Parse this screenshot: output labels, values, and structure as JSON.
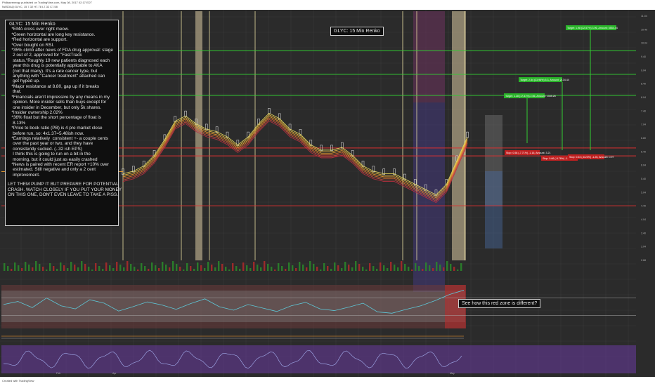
{
  "header": {
    "line1": "Phillyseenergy published on TradingView.com, May 08, 2017 02:17 EDT",
    "line2": "NASDAQ:GLYC, 15 7.32 H7.78 L7.32 C7.58"
  },
  "footer": {
    "credit": "Created with TradingView"
  },
  "note": {
    "title": "GLYC: 15 Min Renko",
    "lines": [
      "   *EMA cross over right meow.",
      "   *Green horizontal are long key resistance.",
      "   *Red horizontal are support.",
      "   *Over bought on RSI.",
      "   *35% climb after news of FDA drug approval: stage",
      "    2 out of 2, approved for \"FastTrack",
      "    status.\"Roughly 19 new patients diagnosed each",
      "    year this drug is potentially applicable to AKA",
      "    (not that many). It's a rare cancer type, but",
      "    anything with \"Cancer treatment\" attached can",
      "    get hyped up.",
      "   *Major resistance at 8.80, gap up if it breaks",
      "    that.",
      "   *Financials aren't impressive by any means in my",
      "    opinion. More insider sells than buys except for",
      "    one insider in December, but only 5k shares.",
      "   *Insider ownership 2.02%",
      "   *36% float but the short percentage of float is",
      "    8.13%",
      "   *Price to book ratio (PB) is 4 pre market close",
      "    before run, so: 4x1.37=5.48ish now.",
      "   *Earnings relatively  consistent +- a couple cents",
      "    over the past year or two, and they have",
      "    consistently sucked. (-.32 ish EPS)",
      "    I think this is going to run on a bit in the",
      "    morning, but it could just as easily crashed",
      "   *News is paired with recent ER report +10% over",
      "    estimated. Still negative and only a 2 cent",
      "    improvement."
    ],
    "warning": "LET THEM PUMP IT BUT PREPARE FOR POTENTIAL\nCRASH. WATCH CLOSELY IF YOU PUT YOUR MONEY\nON THIS ONE, DON'T EVEN LEAVE TO TAKE A PISS."
  },
  "renko_label": "GLYC: 15 Min Renko",
  "red_zone_label": "See how this red zone is different?",
  "colors": {
    "background": "#2b2b2b",
    "resistance": "#33cc33",
    "support": "#e03030",
    "ema_fast": "#f0e060",
    "ema_slow": "#f0a030",
    "rsi": "#5ec8d8",
    "highlight": "#d8c8a0"
  },
  "chart_data": {
    "type": "line",
    "title": "GLYC: 15 Min Renko",
    "series": [
      {
        "values": [
          5.9,
          6.0,
          6.2,
          6.6,
          7.2,
          7.9,
          8.1,
          7.8,
          7.6,
          7.5,
          7.3,
          7.0,
          7.3,
          7.8,
          8.2,
          8.0,
          7.6,
          7.4,
          7.0,
          6.8,
          6.8,
          6.9,
          6.6,
          6.2,
          6.0,
          5.9,
          5.9,
          5.7,
          5.5,
          5.3,
          5.1,
          5.5,
          6.4,
          7.3
        ]
      }
    ],
    "y_right_ticks": [
      "2.68",
      "3.04",
      "3.40",
      "4.04",
      "4.40",
      "5.04",
      "5.40",
      "6.04",
      "6.40",
      "6.80",
      "7.04",
      "7.40",
      "8.04",
      "8.40",
      "9.04",
      "9.40",
      "10.04",
      "10.40",
      "11.04"
    ],
    "price_markers": {
      "resistance": [
        8.8,
        9.6,
        10.5,
        12.8
      ],
      "support": [
        4.6,
        6.5,
        6.8
      ]
    },
    "targets": [
      {
        "label": "Target: 1.98 (32.57%) 3.96, Amount: 5554.44"
      },
      {
        "label": "Target: 2.54 (33.96%) 5.3, Amount: 2134.44"
      },
      {
        "label": "Target: 1.28 (17.51%) 2.56, Amount: 1345.26"
      }
    ],
    "stops": [
      {
        "label": "Stop: 0.58 (-7.71%) -1.16, Amount: 3.21"
      },
      {
        "label": "Stop: 0.66 (-8.76%) -1.32, Amount: 2.49"
      },
      {
        "label": "Stop: 0.63 (-8.23%) -1.26, Amount: 0.97"
      }
    ],
    "rsi": {
      "overbought": 70,
      "oversold": 30,
      "values": [
        55,
        62,
        48,
        70,
        52,
        45,
        66,
        58,
        40,
        50,
        61,
        54,
        44,
        57,
        68,
        50,
        42,
        55,
        47,
        39,
        52,
        60,
        45,
        41,
        49,
        58,
        38,
        35,
        44,
        52,
        64,
        78,
        88
      ]
    },
    "x_ticks": [
      "Feb",
      "Apr",
      "May"
    ]
  }
}
